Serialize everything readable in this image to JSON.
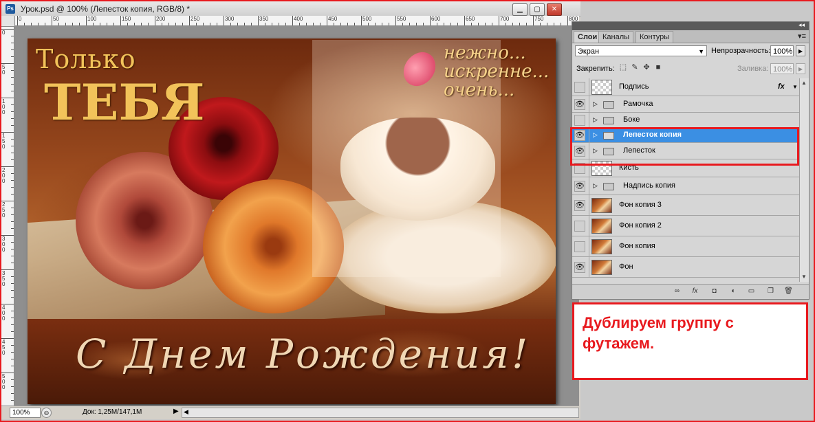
{
  "window": {
    "app_icon": "Ps",
    "title": "Урок.psd @ 100% (Лепесток копия, RGB/8) *",
    "controls": {
      "minimize": "▁",
      "maximize": "▢",
      "close": "✕"
    }
  },
  "rulers": {
    "top_labels": [
      "0",
      "50",
      "100",
      "150",
      "200",
      "250",
      "300",
      "350",
      "400",
      "450",
      "500",
      "550",
      "600",
      "650",
      "700",
      "750",
      "800"
    ],
    "left_labels": [
      "0",
      "50",
      "100",
      "150",
      "200",
      "250",
      "300",
      "350",
      "400",
      "450",
      "500"
    ]
  },
  "artwork": {
    "title_line1": "Только",
    "title_line2": "ТЕБЯ",
    "tagline": [
      "нежно...",
      "искренне...",
      "очень..."
    ],
    "greeting": "С Днем Рождения!"
  },
  "status": {
    "zoom": "100%",
    "doc_size": "Док: 1,25М/147,1М",
    "arrow": "▶",
    "scroll_left": "◀"
  },
  "panel": {
    "collapse": "◂◂",
    "menu_icon": "▾≡",
    "tabs": [
      "Слои",
      "Каналы",
      "Контуры"
    ],
    "blend_mode": "Экран",
    "opacity_label": "Непрозрачность:",
    "opacity": "100%",
    "lock_label": "Закрепить:",
    "fill_label": "Заливка:",
    "fill": "100%",
    "dropdown_arrow": "▼",
    "stepper_arrow": "▶",
    "fx": "fx",
    "layers": [
      {
        "name": "Подпись",
        "kind": "layer",
        "thumb": "transparent",
        "visible": false,
        "selected": false,
        "fx": true
      },
      {
        "name": "Рамочка",
        "kind": "group",
        "visible": true,
        "selected": false
      },
      {
        "name": "Боке",
        "kind": "group",
        "visible": false,
        "selected": false
      },
      {
        "name": "Лепесток копия",
        "kind": "group",
        "visible": true,
        "selected": true
      },
      {
        "name": "Лепесток",
        "kind": "group",
        "visible": true,
        "selected": false
      },
      {
        "name": "Кисть",
        "kind": "layer",
        "thumb": "transparent",
        "visible": false,
        "selected": false
      },
      {
        "name": "Надпись копия",
        "kind": "group",
        "visible": true,
        "selected": false
      },
      {
        "name": "Фон  копия 3",
        "kind": "layer",
        "thumb": "photo",
        "visible": true,
        "selected": false
      },
      {
        "name": "Фон  копия 2",
        "kind": "layer",
        "thumb": "photo",
        "visible": false,
        "selected": false
      },
      {
        "name": "Фон  копия",
        "kind": "layer",
        "thumb": "photo",
        "visible": false,
        "selected": false
      },
      {
        "name": "Фон",
        "kind": "layer",
        "thumb": "photo",
        "visible": true,
        "selected": false
      }
    ]
  },
  "caption": {
    "text": "Дублируем группу с футажем."
  },
  "colors": {
    "highlight": "#e8191e",
    "selection": "#3b8fe3"
  }
}
